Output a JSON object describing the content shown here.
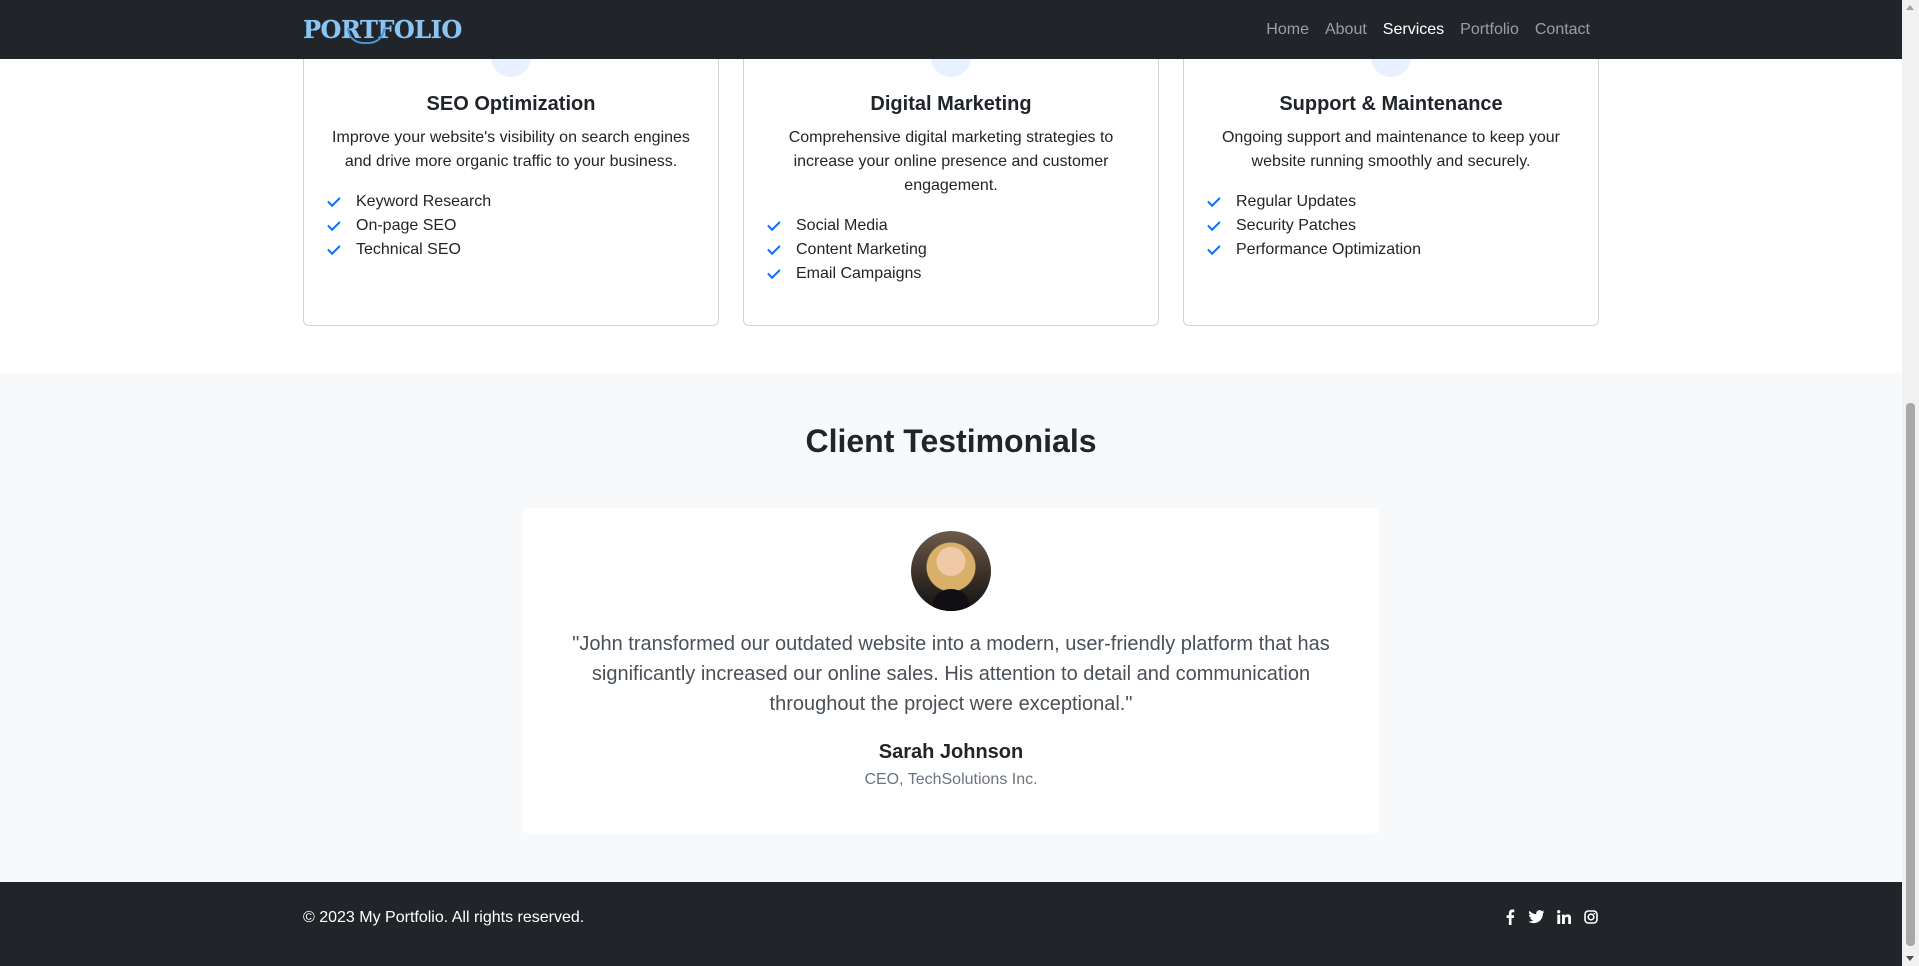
{
  "nav": {
    "brand": "PORTFOLIO",
    "links": [
      "Home",
      "About",
      "Services",
      "Portfolio",
      "Contact"
    ],
    "active": "Services"
  },
  "services": [
    {
      "title": "SEO Optimization",
      "text": "Improve your website's visibility on search engines and drive more organic traffic to your business.",
      "features": [
        "Keyword Research",
        "On-page SEO",
        "Technical SEO"
      ]
    },
    {
      "title": "Digital Marketing",
      "text": "Comprehensive digital marketing strategies to increase your online presence and customer engagement.",
      "features": [
        "Social Media",
        "Content Marketing",
        "Email Campaigns"
      ]
    },
    {
      "title": "Support & Maintenance",
      "text": "Ongoing support and maintenance to keep your website running smoothly and securely.",
      "features": [
        "Regular Updates",
        "Security Patches",
        "Performance Optimization"
      ]
    }
  ],
  "testimonials": {
    "title": "Client Testimonials",
    "quote": "\"John transformed our outdated website into a modern, user-friendly platform that has significantly increased our online sales. His attention to detail and communication throughout the project were exceptional.\"",
    "author": "Sarah Johnson",
    "role": "CEO, TechSolutions Inc."
  },
  "footer": {
    "copyright": "© 2023 My Portfolio. All rights reserved.",
    "socials": [
      "facebook-icon",
      "twitter-icon",
      "linkedin-icon",
      "instagram-icon"
    ]
  },
  "colors": {
    "accent": "#0d6efd",
    "dark": "#212529",
    "light_bg": "#f8f9fa"
  }
}
